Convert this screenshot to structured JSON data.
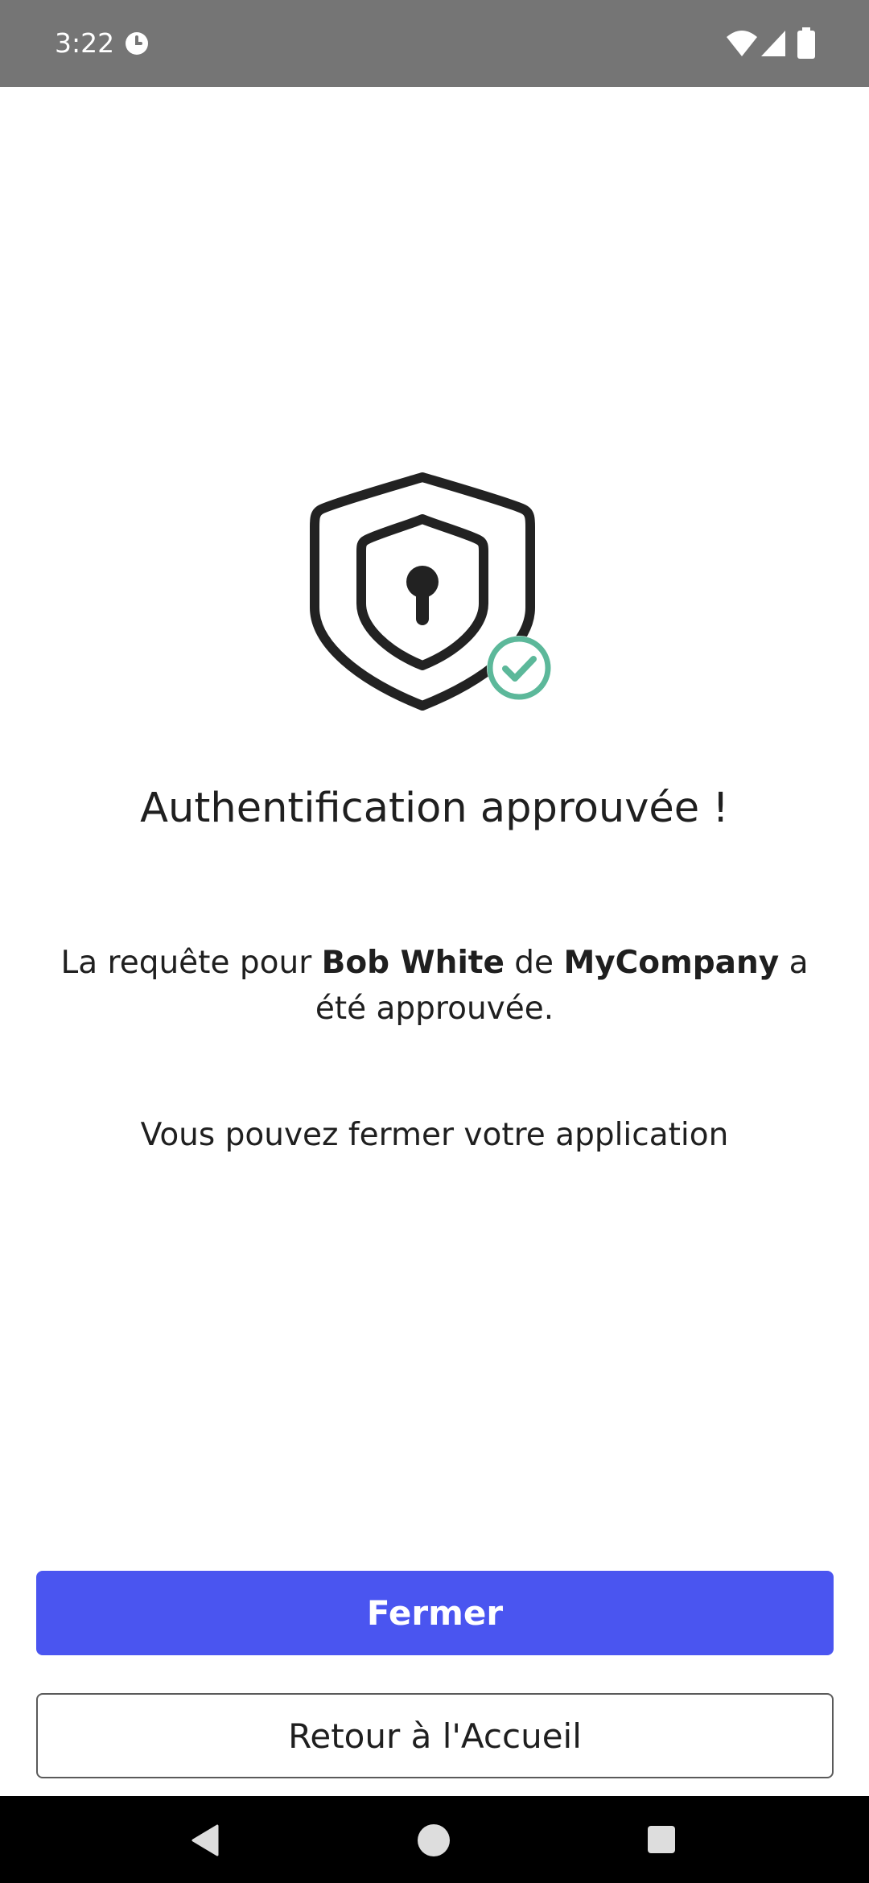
{
  "status_bar": {
    "time": "3:22",
    "app_icon": "clock-badge-icon",
    "wifi_icon": "wifi-icon",
    "signal_icon": "cell-signal-icon",
    "battery_icon": "battery-icon"
  },
  "illustration": {
    "shield_icon": "shield-lock-icon",
    "check_icon": "check-circle-icon",
    "check_color": "#5cb89a"
  },
  "content": {
    "title": "Authentification approuvée !",
    "message": {
      "prefix": "La requête pour ",
      "user": "Bob White",
      "middle": " de ",
      "company": "MyCompany",
      "suffix": " a été approuvée."
    },
    "hint": "Vous pouvez fermer votre application"
  },
  "actions": {
    "close_label": "Fermer",
    "home_label": "Retour à l'Accueil",
    "primary_color": "#4a55f0"
  },
  "nav_bar": {
    "back_icon": "back-triangle-icon",
    "home_icon": "home-circle-icon",
    "recents_icon": "recents-square-icon"
  }
}
